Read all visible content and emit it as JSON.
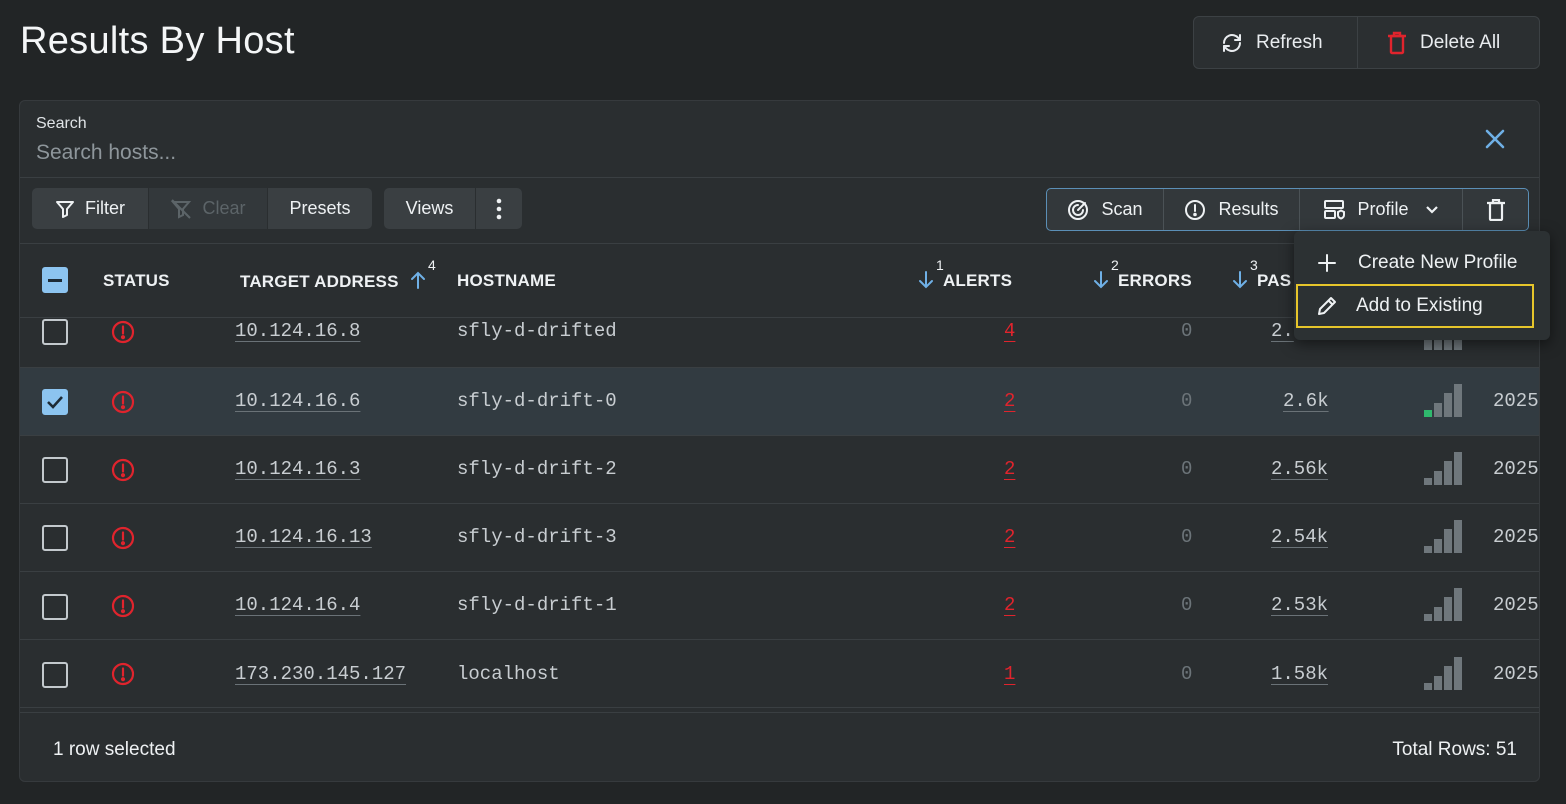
{
  "page": {
    "title": "Results By Host"
  },
  "top_actions": {
    "refresh_label": "Refresh",
    "delete_all_label": "Delete All"
  },
  "search": {
    "label": "Search",
    "placeholder": "Search hosts..."
  },
  "toolbar": {
    "filter_label": "Filter",
    "clear_label": "Clear",
    "presets_label": "Presets",
    "views_label": "Views",
    "scan_label": "Scan",
    "results_label": "Results",
    "profile_label": "Profile"
  },
  "table": {
    "columns": [
      {
        "key": "status",
        "label": "STATUS"
      },
      {
        "key": "target",
        "label": "TARGET ADDRESS",
        "sort_order": "4",
        "sort_dir": "asc"
      },
      {
        "key": "hostname",
        "label": "HOSTNAME"
      },
      {
        "key": "alerts",
        "label": "ALERTS",
        "sort_order": "1",
        "sort_dir": "desc"
      },
      {
        "key": "errors",
        "label": "ERRORS",
        "sort_order": "2",
        "sort_dir": "desc"
      },
      {
        "key": "passes",
        "label": "PAS",
        "sort_order": "3",
        "sort_dir": "desc"
      }
    ],
    "rows": [
      {
        "target": "10.124.16.8",
        "hostname": "sfly-d-drifted",
        "alerts": "4",
        "errors": "0",
        "passes": "2.",
        "date": "",
        "selected": false,
        "signal_green": false
      },
      {
        "target": "10.124.16.6",
        "hostname": "sfly-d-drift-0",
        "alerts": "2",
        "errors": "0",
        "passes": "2.6k",
        "date": "2025",
        "selected": true,
        "signal_green": true
      },
      {
        "target": "10.124.16.3",
        "hostname": "sfly-d-drift-2",
        "alerts": "2",
        "errors": "0",
        "passes": "2.56k",
        "date": "2025",
        "selected": false,
        "signal_green": false
      },
      {
        "target": "10.124.16.13",
        "hostname": "sfly-d-drift-3",
        "alerts": "2",
        "errors": "0",
        "passes": "2.54k",
        "date": "2025",
        "selected": false,
        "signal_green": false
      },
      {
        "target": "10.124.16.4",
        "hostname": "sfly-d-drift-1",
        "alerts": "2",
        "errors": "0",
        "passes": "2.53k",
        "date": "2025",
        "selected": false,
        "signal_green": false
      },
      {
        "target": "173.230.145.127",
        "hostname": "localhost",
        "alerts": "1",
        "errors": "0",
        "passes": "1.58k",
        "date": "2025",
        "selected": false,
        "signal_green": false
      }
    ]
  },
  "footer": {
    "selected_text": "1 row selected",
    "total_text": "Total Rows: 51"
  },
  "profile_menu": {
    "items": [
      {
        "label": "Create New Profile",
        "icon": "plus-icon"
      },
      {
        "label": "Add to Existing",
        "icon": "pencil-icon"
      }
    ]
  },
  "colors": {
    "accent": "#8cc4f0",
    "alert": "#e0242d",
    "highlight": "#e6c52b",
    "signal_green": "#2fb96d"
  }
}
